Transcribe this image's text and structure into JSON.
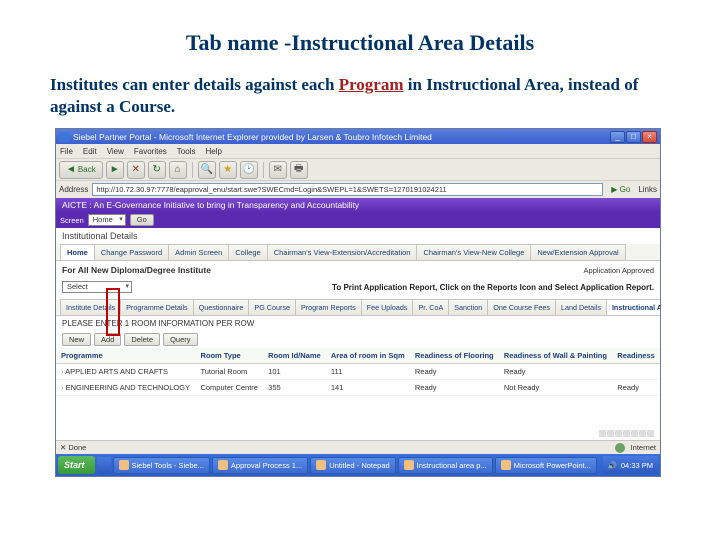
{
  "slide": {
    "title": "Tab name -Instructional Area Details",
    "desc_before": "Institutes can enter details  against each ",
    "desc_program": "Program",
    "desc_after": "  in Instructional Area, instead of against a Course."
  },
  "browser": {
    "title": "Siebel Partner Portal - Microsoft Internet Explorer provided by Larsen & Toubro Infotech Limited",
    "menu": [
      "File",
      "Edit",
      "View",
      "Favorites",
      "Tools",
      "Help"
    ],
    "toolbar": {
      "back": "Back"
    },
    "address_label": "Address",
    "address_value": "http://10.72.30.97:7778/eapproval_enu/start.swe?SWECmd=Login&SWEPL=1&SWETS=1270191024211",
    "go_label": "Go",
    "links_label": "Links"
  },
  "app": {
    "banner": "AICTE : An E-Governance Initiative to bring in Transparency and Accountability",
    "banner2": {
      "screen_label": "Screen",
      "screen_value": "Home",
      "go": "Go"
    },
    "section": "Institutional Details",
    "tabs": [
      "Home",
      "Change Password",
      "Admin Screen",
      "College",
      "Chairman's View-Extension/Accreditation",
      "Chairman's View-New College",
      "New/Extension Approval"
    ],
    "filter_label": "For All New Diploma/Degree Institute",
    "app_id": "Application Approved",
    "select_placeholder": "Select",
    "right_msg": "To Print Application Report, Click on the Reports Icon and Select Application Report.",
    "subtabs": [
      "Institute Details",
      "Programme Details",
      "Questionnaire",
      "PG Course",
      "Program Reports",
      "Fee Uploads",
      "Pr. CoA",
      "Sanction",
      "One Course Fees",
      "Land Details",
      "Instructional Area"
    ],
    "note": "PLEASE ENTER 1 ROOM INFORMATION PER ROW",
    "mini_buttons": [
      "New",
      "Add",
      "Delete",
      "Query"
    ],
    "grid": {
      "headers": [
        "Programme",
        "Room Type",
        "Room Id/Name",
        "Area of room in Sqm",
        "Readiness of Flooring",
        "Readiness of Wall & Painting",
        "Readiness"
      ],
      "rows": [
        [
          "APPLIED ARTS AND CRAFTS",
          "Tutorial Room",
          "101",
          "111",
          "Ready",
          "Ready",
          ""
        ],
        [
          "ENGINEERING AND TECHNOLOGY",
          "Computer Centre",
          "355",
          "141",
          "Ready",
          "Not Ready",
          "Ready"
        ]
      ]
    }
  },
  "status": {
    "done": "Done",
    "zone": "Internet"
  },
  "taskbar": {
    "start": "Start",
    "items": [
      "Siebel Tools - Siebe...",
      "Approval Process 1...",
      "Untitled - Notepad",
      "Instructional area p...",
      "Microsoft PowerPoint..."
    ],
    "time": "04:33 PM"
  }
}
